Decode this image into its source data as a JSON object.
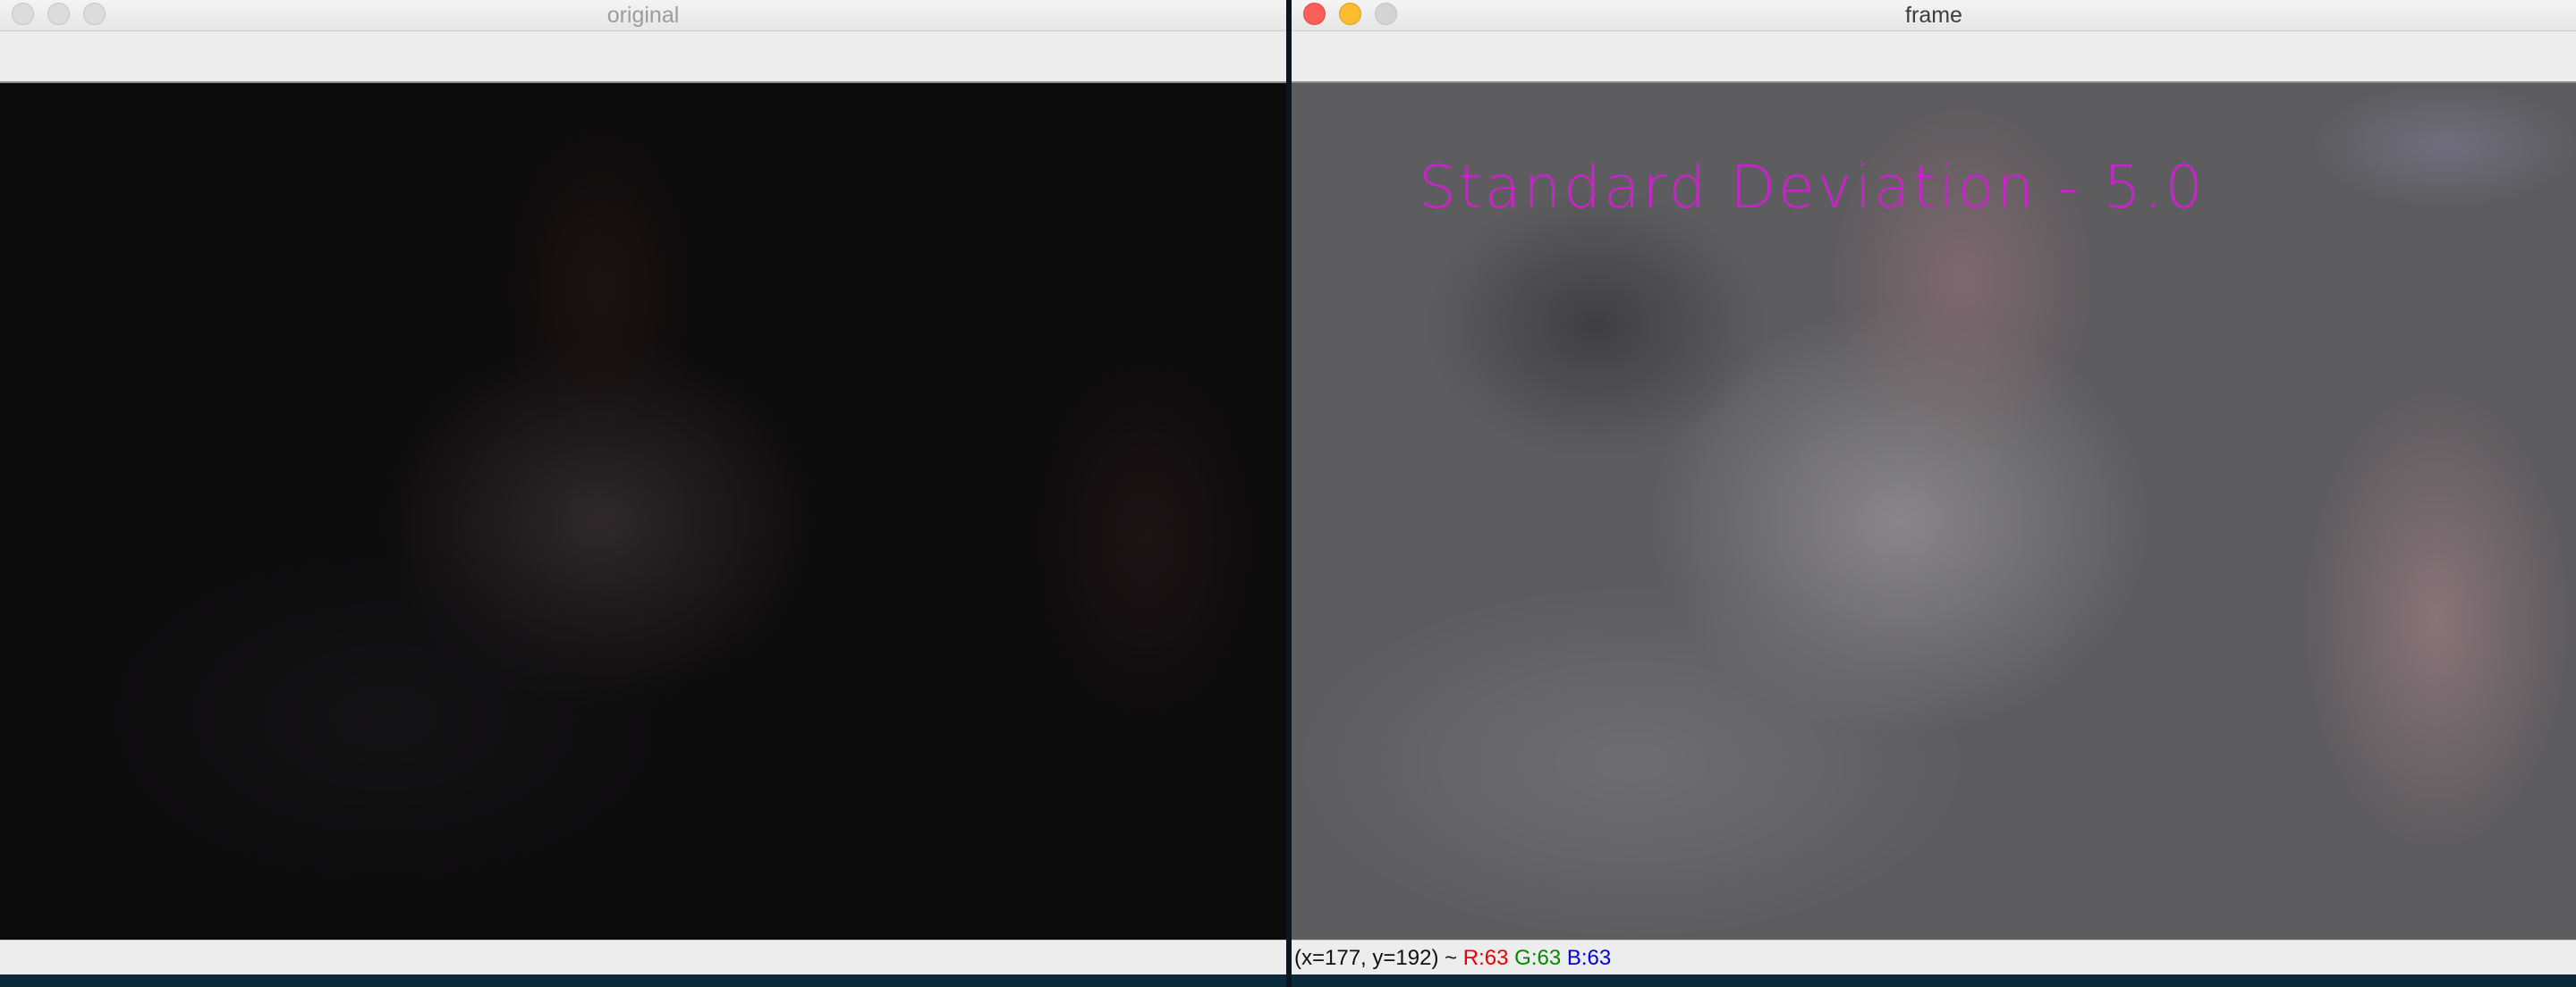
{
  "windows": {
    "original": {
      "title": "original"
    },
    "frame": {
      "title": "frame",
      "overlay_text": "Standard Deviation - 5.0",
      "status": {
        "prefix": "(x=177, y=192) ~ ",
        "r": "R:63",
        "g": "G:63",
        "b": "B:63"
      }
    }
  },
  "icons": [
    "close-icon",
    "minimize-icon",
    "zoom-icon"
  ],
  "colors": {
    "overlay_text": "#cc22cc",
    "status_r": "#e60000",
    "status_g": "#008a00",
    "status_b": "#0000e0",
    "traffic_close": "#fc5f57",
    "traffic_minimize": "#fdbc2e"
  }
}
